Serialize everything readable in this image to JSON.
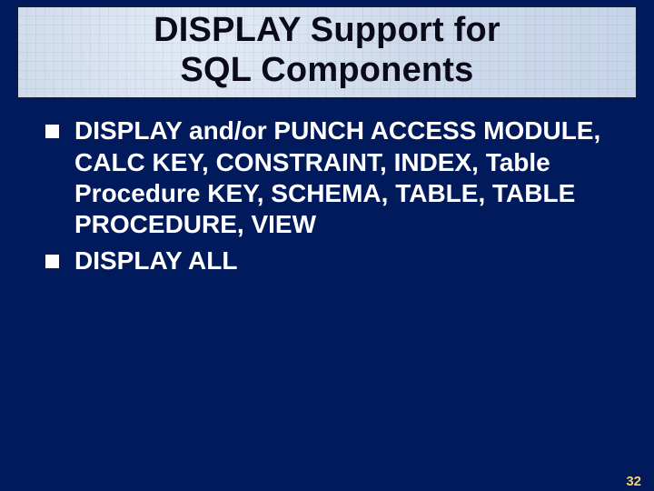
{
  "slide": {
    "title_line1": "DISPLAY Support for",
    "title_line2": "SQL Components",
    "bullets": [
      "DISPLAY and/or PUNCH ACCESS MODULE, CALC KEY, CONSTRAINT, INDEX, Table Procedure KEY, SCHEMA, TABLE, TABLE PROCEDURE, VIEW",
      "DISPLAY ALL"
    ],
    "page_number": "32"
  }
}
